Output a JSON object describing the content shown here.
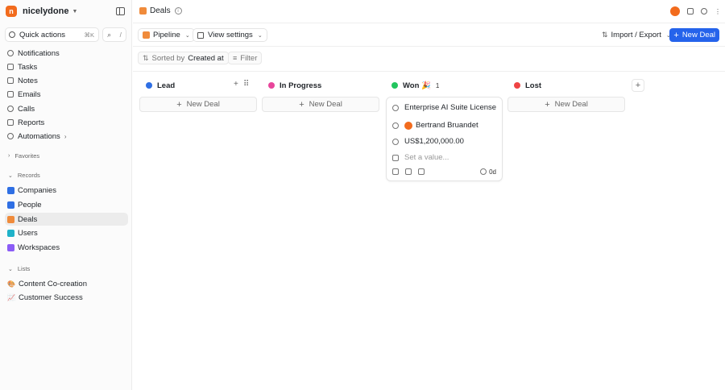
{
  "workspace": {
    "logo_letter": "n",
    "name": "nicelydone"
  },
  "sidebar": {
    "quick_actions": {
      "label": "Quick actions",
      "shortcut": "⌘K"
    },
    "search_shortcut": "/",
    "nav": [
      {
        "label": "Notifications",
        "icon": "bell-icon"
      },
      {
        "label": "Tasks",
        "icon": "check-square-icon"
      },
      {
        "label": "Notes",
        "icon": "note-icon"
      },
      {
        "label": "Emails",
        "icon": "mail-icon"
      },
      {
        "label": "Calls",
        "icon": "phone-icon"
      },
      {
        "label": "Reports",
        "icon": "chart-icon"
      },
      {
        "label": "Automations",
        "icon": "bolt-icon"
      }
    ],
    "favorites_label": "Favorites",
    "records_label": "Records",
    "records": [
      {
        "label": "Companies",
        "color": "#2f6fe4"
      },
      {
        "label": "People",
        "color": "#2f6fe4"
      },
      {
        "label": "Deals",
        "color": "#f08b3b"
      },
      {
        "label": "Users",
        "color": "#1fb2c9"
      },
      {
        "label": "Workspaces",
        "color": "#8b5cf6"
      }
    ],
    "lists_label": "Lists",
    "lists": [
      {
        "label": "Content Co-creation",
        "emoji": "🎨"
      },
      {
        "label": "Customer Success",
        "emoji": "📈"
      }
    ]
  },
  "header": {
    "title": "Deals"
  },
  "toolbar": {
    "pipeline_label": "Pipeline",
    "view_settings_label": "View settings",
    "import_export_label": "Import / Export",
    "new_deal_label": "New Deal"
  },
  "filterbar": {
    "sorted_by_label": "Sorted by",
    "sorted_by_value": "Created at",
    "filter_label": "Filter"
  },
  "columns": [
    {
      "name": "Lead",
      "color": "#2f6fe4",
      "count": ""
    },
    {
      "name": "In Progress",
      "color": "#e8459b",
      "count": ""
    },
    {
      "name": "Won 🎉",
      "color": "#22c55e",
      "count": "1"
    },
    {
      "name": "Lost",
      "color": "#ef4444",
      "count": ""
    }
  ],
  "new_card_label": "New Deal",
  "deal_card": {
    "name": "Enterprise AI Suite License",
    "owner": "Bertrand Bruandet",
    "value": "US$1,200,000.00",
    "placeholder": "Set a value...",
    "age": "0d"
  }
}
